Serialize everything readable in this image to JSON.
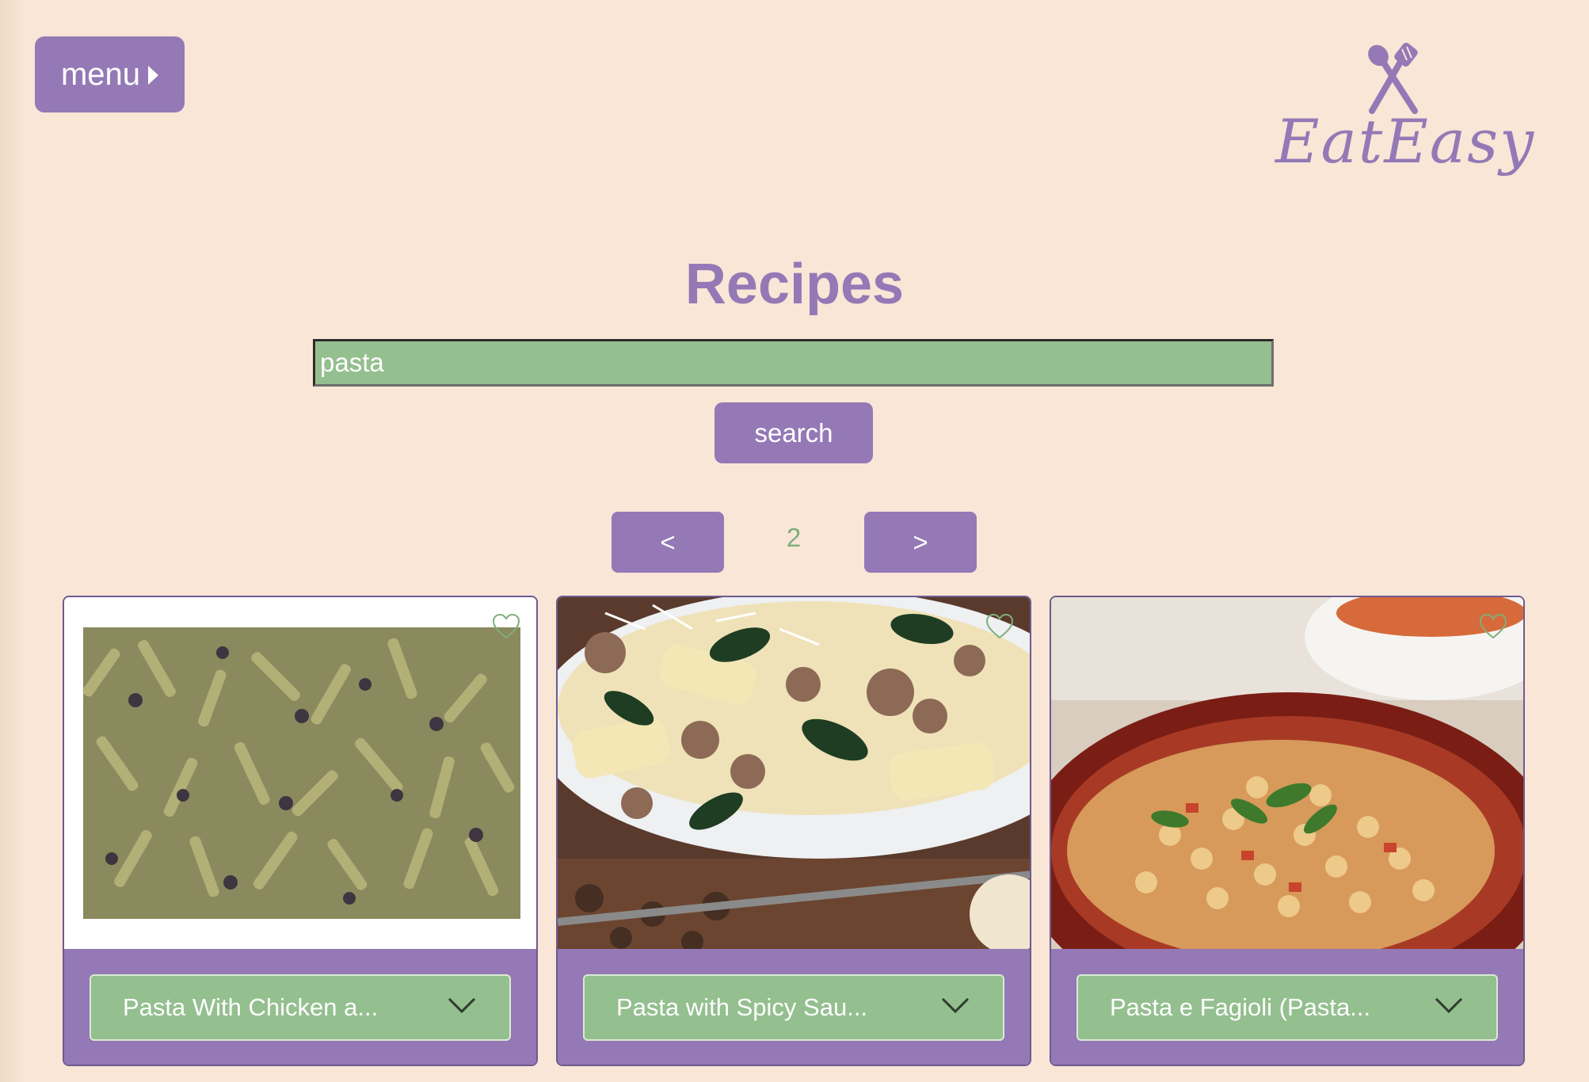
{
  "header": {
    "menu_label": "menu",
    "logo_text": "EatEasy"
  },
  "page": {
    "title": "Recipes"
  },
  "search": {
    "value": "pasta",
    "button_label": "search"
  },
  "pagination": {
    "prev_label": "<",
    "current_page": "2",
    "next_label": ">"
  },
  "recipes": [
    {
      "title": "Pasta With Chicken a...",
      "favorited": false,
      "image": "penne-with-olives-photo"
    },
    {
      "title": "Pasta with Spicy Sau...",
      "favorited": false,
      "image": "bowtie-sausage-spinach-photo"
    },
    {
      "title": "Pasta e Fagioli (Pasta...",
      "favorited": false,
      "image": "macaroni-bean-soup-photo"
    }
  ],
  "colors": {
    "background": "#f9e6d6",
    "purple": "#9479b6",
    "green": "#94bf8f"
  },
  "icons": {
    "menu_caret": "caret-right-icon",
    "logo_icon": "spoon-spatula-icon",
    "favorite": "heart-outline-icon",
    "expand": "chevron-down-icon"
  }
}
